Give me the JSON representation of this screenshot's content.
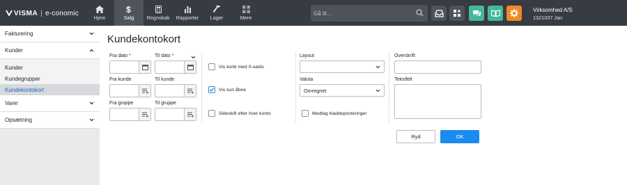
{
  "app": {
    "brand": "VISMA",
    "product": "e-conomic"
  },
  "nav": [
    {
      "label": "Hjem",
      "icon": "home-icon"
    },
    {
      "label": "Salg",
      "icon": "dollar-icon"
    },
    {
      "label": "Regnskab",
      "icon": "calculator-icon"
    },
    {
      "label": "Rapporter",
      "icon": "bar-chart-icon"
    },
    {
      "label": "Lager",
      "icon": "hammer-icon"
    },
    {
      "label": "Mere",
      "icon": "grid-icon"
    }
  ],
  "search": {
    "placeholder": "Gå til..."
  },
  "toolbar_icons": [
    "inbox-icon",
    "apps-icon",
    "chat-icon",
    "book-icon",
    "gear-icon"
  ],
  "colors": {
    "topbar": "#373b43",
    "chat": "#45b89a",
    "book": "#45b89a",
    "gear": "#f08a24",
    "primary": "#1a8cf0",
    "link": "#1f63c6"
  },
  "company": {
    "name": "Virksomhed A/S",
    "user": "1321037 Jan"
  },
  "sidebar": {
    "groups": [
      {
        "label": "Fakturering",
        "expanded": false
      },
      {
        "label": "Kunder",
        "expanded": true,
        "items": [
          "Kunder",
          "Kundegrupper",
          "Kundekontokort"
        ],
        "active": "Kundekontokort"
      },
      {
        "label": "Varer",
        "expanded": false
      },
      {
        "label": "Opsætning",
        "expanded": false
      }
    ]
  },
  "main": {
    "title": "Kundekontokort",
    "fields": {
      "fra_dato": {
        "label": "Fra dato *",
        "value": ""
      },
      "til_dato": {
        "label": "Til dato *",
        "value": ""
      },
      "fra_kunde": {
        "label": "Fra kunde",
        "value": ""
      },
      "til_kunde": {
        "label": "Til kunde",
        "value": ""
      },
      "fra_gruppe": {
        "label": "Fra gruppe",
        "value": ""
      },
      "til_gruppe": {
        "label": "Til gruppe",
        "value": ""
      }
    },
    "checkboxes": {
      "vis_konti": {
        "label": "Vis konti med 0-saldo",
        "checked": false
      },
      "vis_kun_abne": {
        "label": "Vis kun åbne",
        "checked": true
      },
      "sideskift": {
        "label": "Sideskift efter hver konto",
        "checked": false
      },
      "medtag_kladde": {
        "label": "Medtag kladdeposteringer",
        "checked": false
      }
    },
    "layout": {
      "label": "Layout",
      "value": ""
    },
    "valuta": {
      "label": "Valuta",
      "value": "Omregnet"
    },
    "overskrift": {
      "label": "Overskrift",
      "value": ""
    },
    "tekstfelt": {
      "label": "Tekstfelt",
      "value": ""
    },
    "buttons": {
      "clear": "Ryd",
      "ok": "OK"
    }
  }
}
